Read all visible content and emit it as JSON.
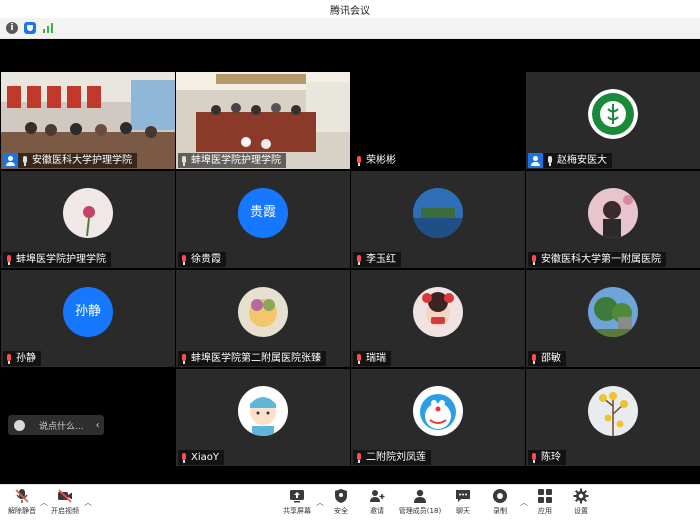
{
  "window": {
    "title": "腾讯会议"
  },
  "status_icons": [
    "info-icon",
    "shield-icon",
    "signal-icon"
  ],
  "participants": [
    {
      "name": "安徽医科大学护理学院",
      "host": true,
      "muted": false,
      "tile": "photo"
    },
    {
      "name": "蚌埠医学院护理学院",
      "host": false,
      "muted": false,
      "tile": "photo"
    },
    {
      "name": "荣彬彬",
      "host": false,
      "muted": true,
      "tile": "blank"
    },
    {
      "name": "赵梅安医大",
      "host": true,
      "muted": false,
      "tile": "logo"
    },
    {
      "name": "蚌埠医学院护理学院",
      "host": false,
      "muted": true,
      "tile": "avatar"
    },
    {
      "name": "徐贵霞",
      "host": false,
      "muted": true,
      "tile": "text-avatar",
      "avatar_text": "贵霞"
    },
    {
      "name": "李玉红",
      "host": false,
      "muted": true,
      "tile": "avatar"
    },
    {
      "name": "安徽医科大学第一附属医院",
      "host": false,
      "muted": true,
      "tile": "avatar"
    },
    {
      "name": "孙静",
      "host": false,
      "muted": true,
      "tile": "text-avatar",
      "avatar_text": "孙静"
    },
    {
      "name": "蚌埠医学院第二附属医院张臻",
      "host": false,
      "muted": true,
      "tile": "avatar"
    },
    {
      "name": "瑞瑞",
      "host": false,
      "muted": true,
      "tile": "avatar"
    },
    {
      "name": "邵敏",
      "host": false,
      "muted": true,
      "tile": "avatar"
    },
    {
      "name": "XiaoY",
      "host": false,
      "muted": true,
      "tile": "avatar"
    },
    {
      "name": "二附院刘凤莲",
      "host": false,
      "muted": true,
      "tile": "avatar"
    },
    {
      "name": "陈玲",
      "host": false,
      "muted": true,
      "tile": "avatar"
    }
  ],
  "chat": {
    "placeholder": "说点什么..."
  },
  "toolbar": {
    "unmute": "解除静音",
    "start_video": "开启视频",
    "share_screen": "共享屏幕",
    "security": "安全",
    "invite": "邀请",
    "manage_members": "管理成员(18)",
    "chat": "聊天",
    "record": "录制",
    "apps": "应用",
    "settings": "设置"
  },
  "colors": {
    "accent": "#1677ff",
    "muted_mic": "#ff4d4f",
    "host_badge": "#1a73e8"
  }
}
